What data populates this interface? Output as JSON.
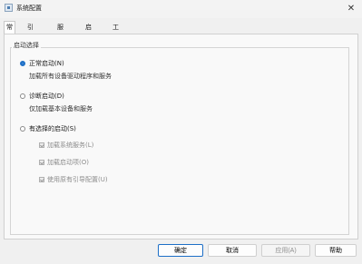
{
  "window": {
    "title": "系统配置"
  },
  "tabs": [
    {
      "label": "常规",
      "active": true
    },
    {
      "label": "引导",
      "active": false
    },
    {
      "label": "服务",
      "active": false
    },
    {
      "label": "启动",
      "active": false
    },
    {
      "label": "工具",
      "active": false
    }
  ],
  "startup": {
    "group_title": "启动选择",
    "normal": {
      "label": "正常启动(N)",
      "desc": "加载所有设备驱动程序和服务",
      "selected": true
    },
    "diagnostic": {
      "label": "诊断启动(D)",
      "desc": "仅加载基本设备和服务",
      "selected": false
    },
    "selective": {
      "label": "有选择的启动(S)",
      "selected": false,
      "options": [
        {
          "label": "加载系统服务(L)",
          "checked": true,
          "enabled": false
        },
        {
          "label": "加载启动项(O)",
          "checked": true,
          "enabled": false
        },
        {
          "label": "使用原有引导配置(U)",
          "checked": true,
          "enabled": false
        }
      ]
    }
  },
  "buttons": {
    "ok": "确定",
    "cancel": "取消",
    "apply": "应用(A)",
    "help": "帮助"
  },
  "colors": {
    "accent": "#1d6fc7"
  }
}
